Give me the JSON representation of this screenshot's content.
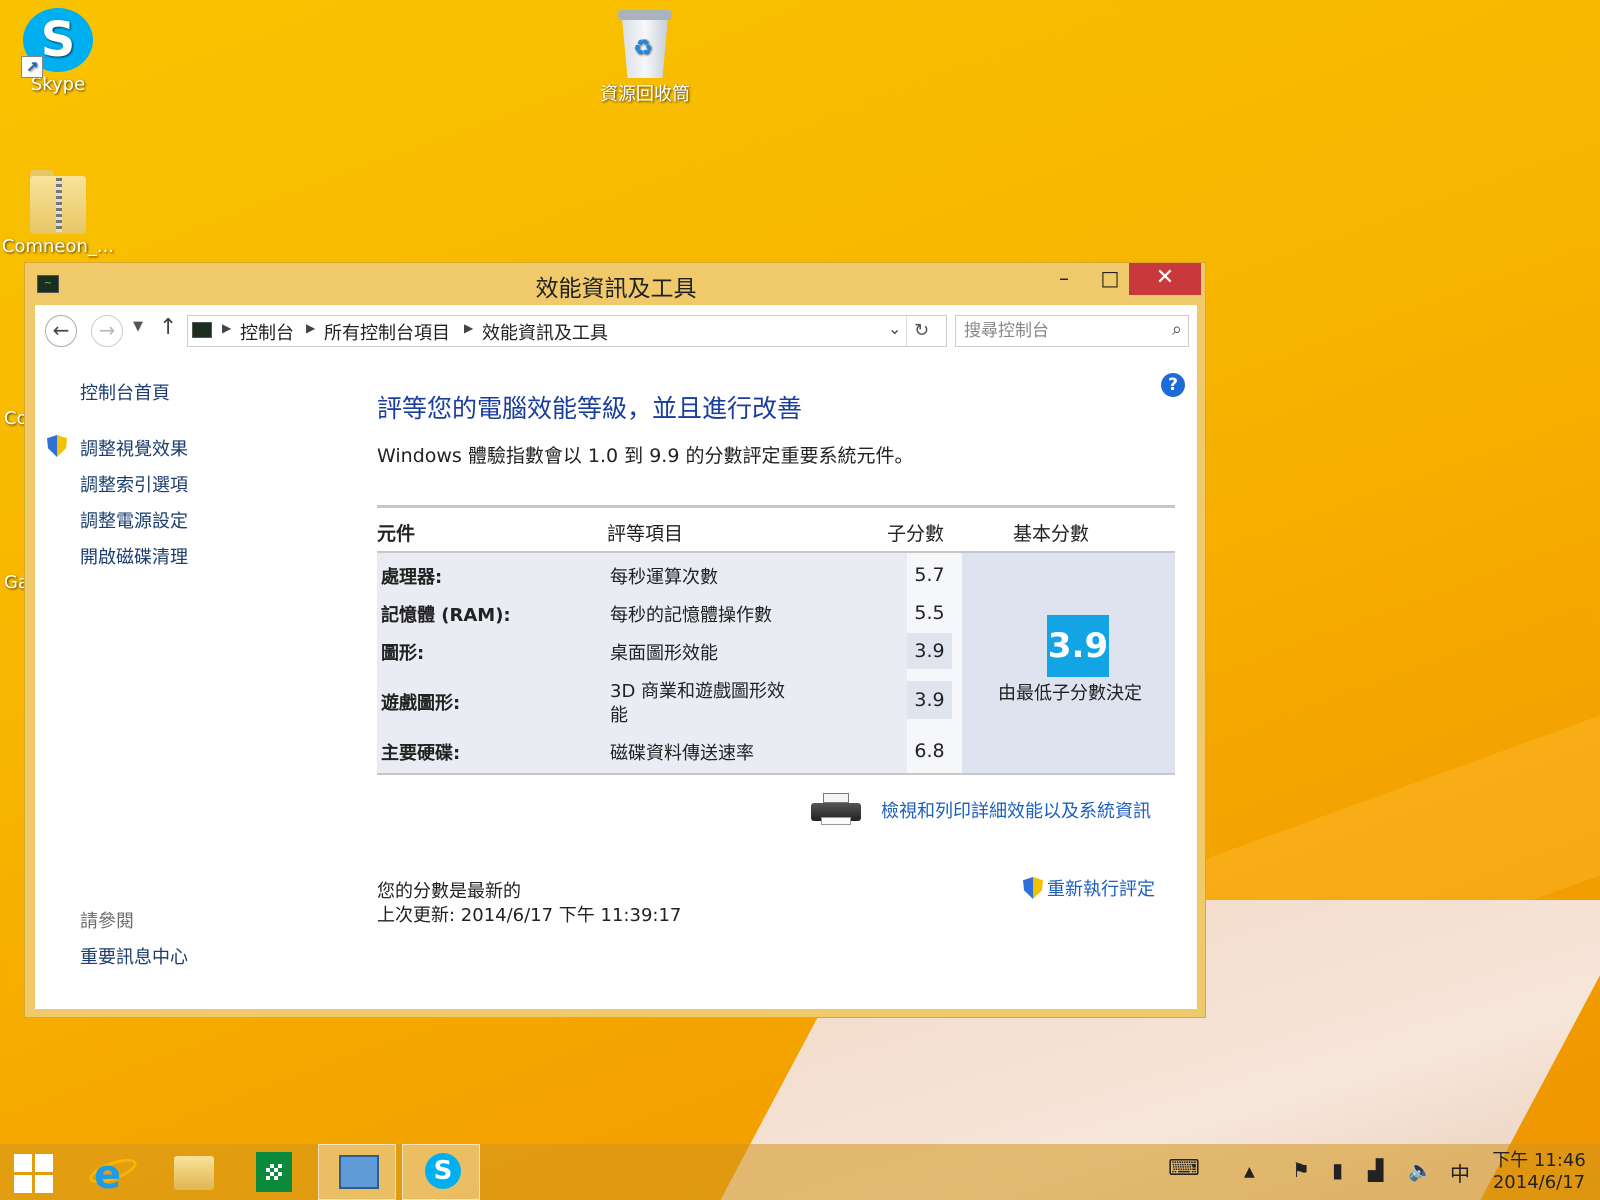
{
  "desktop": {
    "icons": [
      {
        "label": "Skype"
      },
      {
        "label": "資源回收筒"
      },
      {
        "label": "Comneon_..."
      }
    ],
    "cut_labels": [
      "Co",
      "Ga"
    ]
  },
  "window": {
    "title": "效能資訊及工具",
    "minimize": "–",
    "maximize": "□",
    "close": "✕"
  },
  "address_bar": {
    "breadcrumbs": [
      "控制台",
      "所有控制台項目",
      "效能資訊及工具"
    ],
    "search_placeholder": "搜尋控制台"
  },
  "left_pane": {
    "home": "控制台首頁",
    "links": [
      "調整視覺效果",
      "調整索引選項",
      "調整電源設定",
      "開啟磁碟清理"
    ],
    "see_also_title": "請參閱",
    "see_also_links": [
      "重要訊息中心"
    ]
  },
  "main": {
    "title": "評等您的電腦效能等級，並且進行改善",
    "description": "Windows 體驗指數會以 1.0 到 9.9 的分數評定重要系統元件。",
    "headers": {
      "component": "元件",
      "rated": "評等項目",
      "subscore": "子分數",
      "base": "基本分數"
    },
    "rows": [
      {
        "component": "處理器:",
        "rated": "每秒運算次數",
        "subscore": "5.7"
      },
      {
        "component": "記憶體 (RAM):",
        "rated": "每秒的記憶體操作數",
        "subscore": "5.5"
      },
      {
        "component": "圖形:",
        "rated": "桌面圖形效能",
        "subscore": "3.9"
      },
      {
        "component": "遊戲圖形:",
        "rated_line1": "3D 商業和遊戲圖形效",
        "rated_line2": "能",
        "subscore": "3.9"
      },
      {
        "component": "主要硬碟:",
        "rated": "磁碟資料傳送速率",
        "subscore": "6.8"
      }
    ],
    "base_score": "3.9",
    "base_note": "由最低子分數決定",
    "print_link": "檢視和列印詳細效能以及系統資訊",
    "status_line1": "您的分數是最新的",
    "status_line2": "上次更新: 2014/6/17 下午 11:39:17",
    "rerun_link": "重新執行評定"
  },
  "taskbar": {
    "ime": "中",
    "time": "下午 11:46",
    "date": "2014/6/17"
  },
  "colors": {
    "accent_blue": "#1a3d9e",
    "link_blue": "#1b5fbf",
    "close_red": "#c8383d",
    "base_score_bg": "#13a4e6"
  }
}
